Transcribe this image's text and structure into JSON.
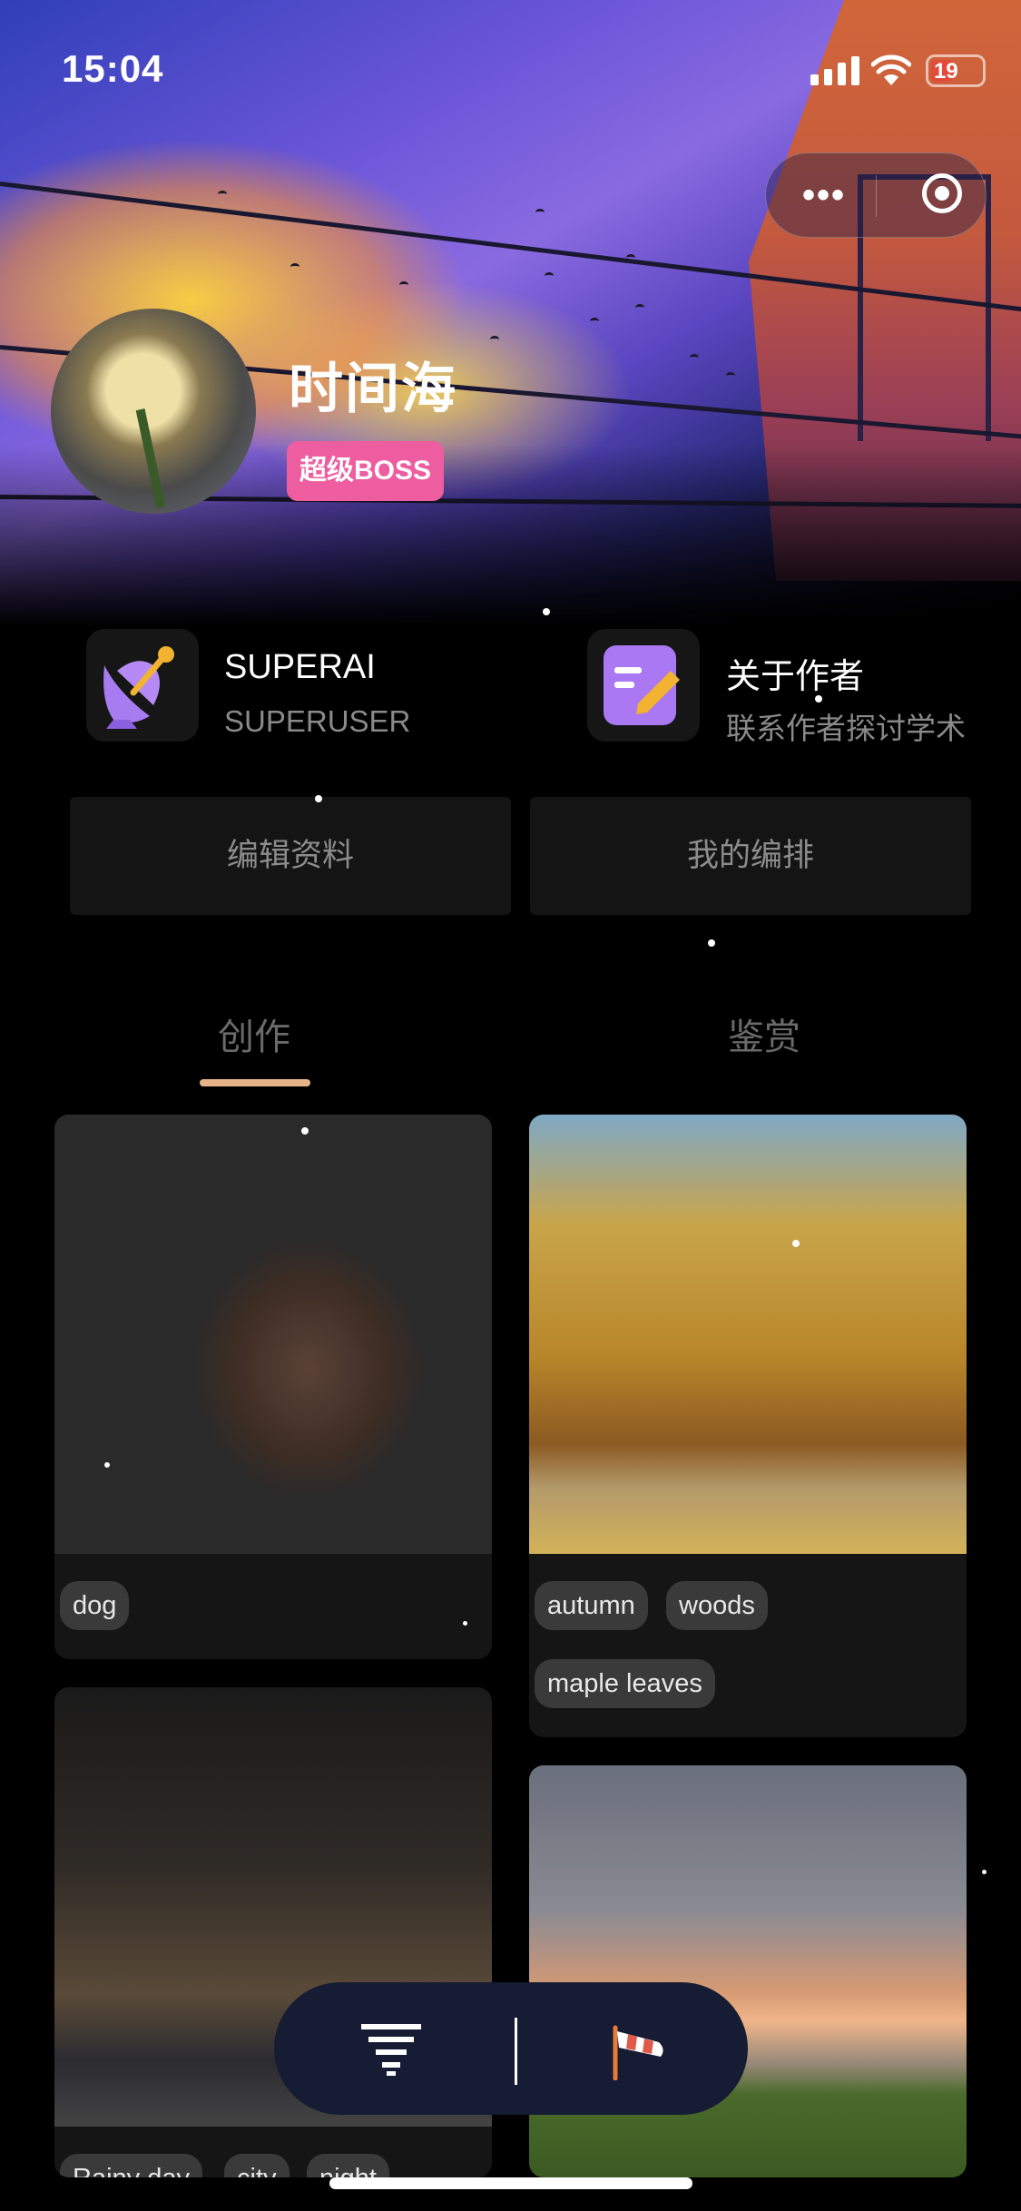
{
  "status": {
    "time": "15:04",
    "battery": "19"
  },
  "profile": {
    "name": "时间海",
    "badge": "超级BOSS"
  },
  "features": [
    {
      "title": "SUPERAI",
      "subtitle": "SUPERUSER",
      "icon": "satellite-dish-icon"
    },
    {
      "title": "关于作者",
      "subtitle": "联系作者探讨学术",
      "icon": "note-edit-icon"
    }
  ],
  "actions": {
    "edit_profile": "编辑资料",
    "my_arrangement": "我的编排"
  },
  "tabs": [
    {
      "label": "创作",
      "active": true
    },
    {
      "label": "鉴赏",
      "active": false
    }
  ],
  "gallery": [
    {
      "subject": "dog",
      "tags": [
        "dog"
      ]
    },
    {
      "subject": "autumn-woods",
      "tags": [
        "autumn",
        "woods",
        "maple leaves"
      ]
    },
    {
      "subject": "city-night",
      "tags": [
        "Rainy day",
        "city",
        "night"
      ]
    },
    {
      "subject": "sunset-field",
      "tags": []
    }
  ],
  "fab": {
    "left_icon": "filter-icon",
    "right_icon": "windsock-icon"
  },
  "colors": {
    "accent": "#e7b48a",
    "badge": "#ee5d9f",
    "fab_bg": "#151c33"
  }
}
